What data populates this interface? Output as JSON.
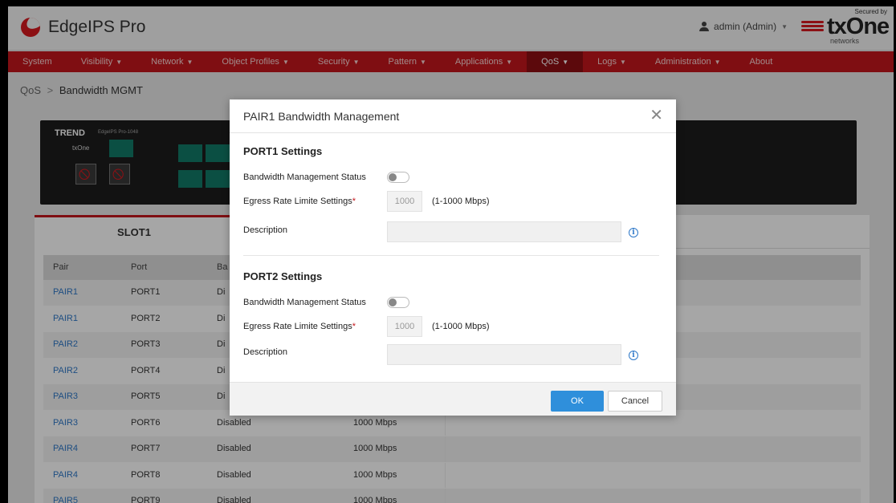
{
  "app": {
    "name": "EdgeIPS Pro"
  },
  "user": {
    "label": "admin (Admin)"
  },
  "partner": {
    "secured_by": "Secured by",
    "brand": "txOne",
    "sub": "networks"
  },
  "nav": [
    {
      "label": "System",
      "caret": ""
    },
    {
      "label": "Visibility",
      "caret": "▼"
    },
    {
      "label": "Network",
      "caret": "▼"
    },
    {
      "label": "Object Profiles",
      "caret": "▼"
    },
    {
      "label": "Security",
      "caret": "▼"
    },
    {
      "label": "Pattern",
      "caret": "▼"
    },
    {
      "label": "Applications",
      "caret": "▼"
    },
    {
      "label": "QoS",
      "caret": "▼"
    },
    {
      "label": "Logs",
      "caret": "▼"
    },
    {
      "label": "Administration",
      "caret": "▼"
    },
    {
      "label": "About",
      "caret": ""
    }
  ],
  "breadcrumb": {
    "root": "QoS",
    "sep": ">",
    "current": "Bandwidth MGMT"
  },
  "device": {
    "brand": "TREND",
    "model": "EdgeIPS Pro-1048",
    "partner": "txOne"
  },
  "slot_tab": "SLOT1",
  "table": {
    "headers": [
      "Pair",
      "Port",
      "Ba",
      "",
      ""
    ],
    "rows": [
      {
        "pair": "PAIR1",
        "port": "PORT1",
        "status": "Di",
        "rate": ""
      },
      {
        "pair": "PAIR1",
        "port": "PORT2",
        "status": "Di",
        "rate": ""
      },
      {
        "pair": "PAIR2",
        "port": "PORT3",
        "status": "Di",
        "rate": ""
      },
      {
        "pair": "PAIR2",
        "port": "PORT4",
        "status": "Di",
        "rate": ""
      },
      {
        "pair": "PAIR3",
        "port": "PORT5",
        "status": "Di",
        "rate": ""
      },
      {
        "pair": "PAIR3",
        "port": "PORT6",
        "status": "Disabled",
        "rate": "1000 Mbps"
      },
      {
        "pair": "PAIR4",
        "port": "PORT7",
        "status": "Disabled",
        "rate": "1000 Mbps"
      },
      {
        "pair": "PAIR4",
        "port": "PORT8",
        "status": "Disabled",
        "rate": "1000 Mbps"
      },
      {
        "pair": "PAIR5",
        "port": "PORT9",
        "status": "Disabled",
        "rate": "1000 Mbps"
      }
    ]
  },
  "modal": {
    "title": "PAIR1 Bandwidth Management",
    "port1": {
      "section": "PORT1 Settings",
      "status_label": "Bandwidth Management Status",
      "status_on": false,
      "egress_label": "Egress Rate Limite Settings",
      "required_mark": "*",
      "egress_value": "1000",
      "egress_hint": "(1-1000 Mbps)",
      "desc_label": "Description",
      "desc_value": ""
    },
    "port2": {
      "section": "PORT2 Settings",
      "status_label": "Bandwidth Management Status",
      "status_on": false,
      "egress_label": "Egress Rate Limite Settings",
      "required_mark": "*",
      "egress_value": "1000",
      "egress_hint": "(1-1000 Mbps)",
      "desc_label": "Description",
      "desc_value": ""
    },
    "ok_label": "OK",
    "cancel_label": "Cancel",
    "close_glyph": "✕",
    "info_glyph": "i"
  },
  "colors": {
    "nav_red": "#c4161c",
    "nav_active": "#8e0f13",
    "link_blue": "#2e78c8",
    "ok_blue": "#2f8fdb"
  }
}
